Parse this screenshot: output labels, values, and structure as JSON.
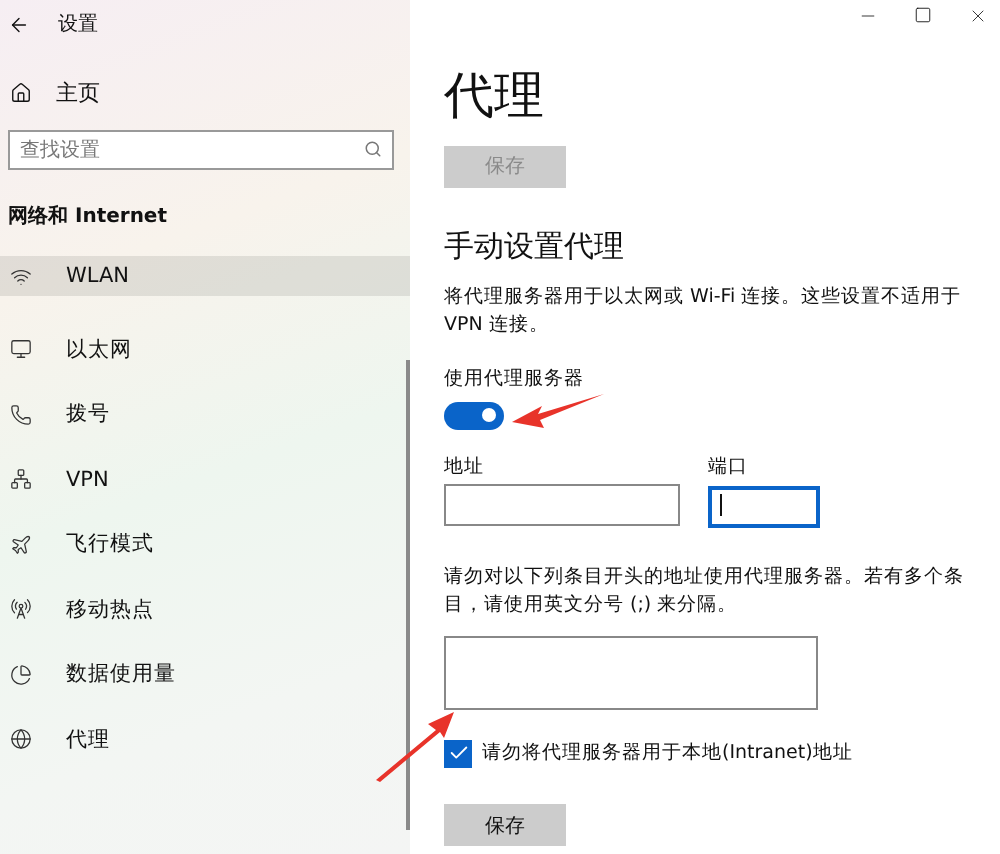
{
  "window": {
    "title": "设置"
  },
  "sidebar": {
    "home": "主页",
    "search": {
      "placeholder": "查找设置"
    },
    "section": "网络和 Internet",
    "items": [
      {
        "label": "WLAN",
        "selected": true
      },
      {
        "label": "以太网",
        "selected": false
      },
      {
        "label": "拨号",
        "selected": false
      },
      {
        "label": "VPN",
        "selected": false
      },
      {
        "label": "飞行模式",
        "selected": false
      },
      {
        "label": "移动热点",
        "selected": false
      },
      {
        "label": "数据使用量",
        "selected": false
      },
      {
        "label": "代理",
        "selected": false
      }
    ]
  },
  "page": {
    "title": "代理",
    "top_button": {
      "label": "保存",
      "disabled": true
    },
    "section": "手动设置代理",
    "description": "将代理服务器用于以太网或 Wi-Fi 连接。这些设置不适用于 VPN 连接。",
    "toggle": {
      "label": "使用代理服务器",
      "on": true
    },
    "address": {
      "label": "地址"
    },
    "port": {
      "label": "端口",
      "focused": true
    },
    "exceptions_text": "请勿对以下列条目开头的地址使用代理服务器。若有多个条目，请使用英文分号 (;) 来分隔。",
    "local_checkbox": {
      "label": "请勿将代理服务器用于本地(Intranet)地址",
      "checked": true
    },
    "save_button": {
      "label": "保存",
      "disabled": false
    }
  }
}
